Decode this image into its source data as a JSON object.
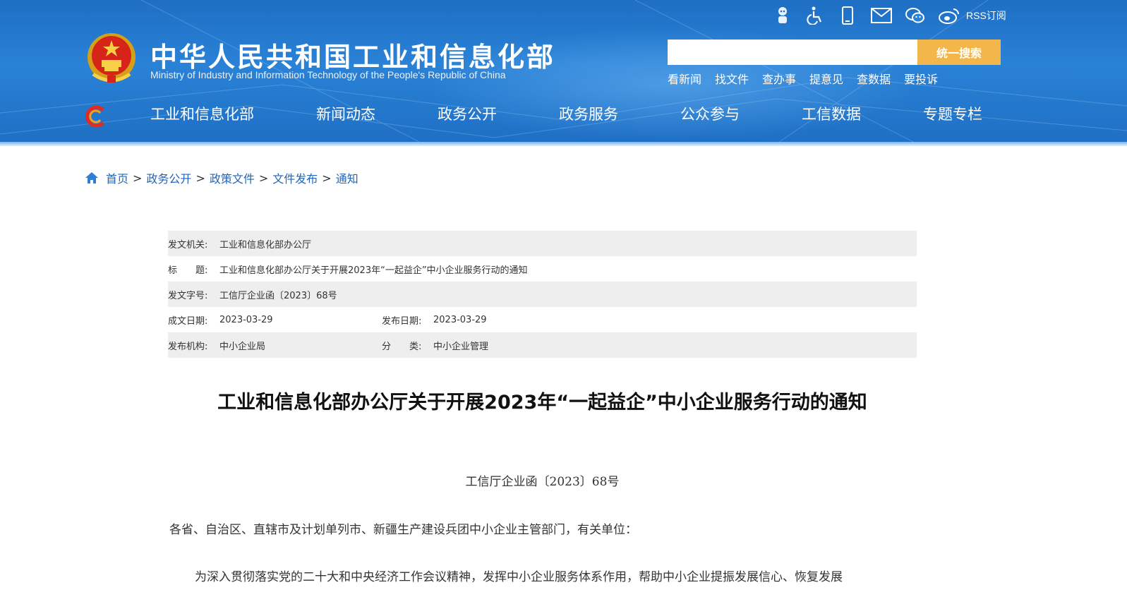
{
  "header": {
    "title_cn": "中华人民共和国工业和信息化部",
    "title_en": "Ministry of Industry and Information Technology of the People's Republic of China",
    "tools": [
      {
        "icon": "robot-icon"
      },
      {
        "icon": "accessibility-icon"
      },
      {
        "icon": "mobile-icon"
      },
      {
        "icon": "mail-icon"
      },
      {
        "icon": "wechat-icon"
      },
      {
        "icon": "weibo-icon"
      }
    ],
    "rss_label": "RSS订阅",
    "search": {
      "placeholder": "",
      "button_label": "统一搜索"
    },
    "quick_links": [
      "看新闻",
      "找文件",
      "查办事",
      "提意见",
      "查数据",
      "要投诉"
    ],
    "nav": [
      "工业和信息化部",
      "新闻动态",
      "政务公开",
      "政务服务",
      "公众参与",
      "工信数据",
      "专题专栏"
    ],
    "colors": {
      "header_blue": "#1e6fc4",
      "search_button": "#f2b64b",
      "link_blue": "#2266b8"
    }
  },
  "breadcrumb": {
    "items": [
      "首页",
      "政务公开",
      "政策文件",
      "文件发布",
      "通知"
    ],
    "separator": ">"
  },
  "meta": {
    "issuer_label": "发文机关:",
    "issuer": "工业和信息化部办公厅",
    "title_label": "标　　题:",
    "title": "工业和信息化部办公厅关于开展2023年“一起益企”中小企业服务行动的通知",
    "docno_label": "发文字号:",
    "docno": "工信厅企业函〔2023〕68号",
    "created_label": "成文日期:",
    "created": "2023-03-29",
    "published_label": "发布日期:",
    "published": "2023-03-29",
    "agency_label": "发布机构:",
    "agency": "中小企业局",
    "category_label": "分　　类:",
    "category": "中小企业管理"
  },
  "article": {
    "title": "工业和信息化部办公厅关于开展2023年“一起益企”中小企业服务行动的通知",
    "doc_number": "工信厅企业函〔2023〕68号",
    "salutation": "各省、自治区、直辖市及计划单列市、新疆生产建设兵团中小企业主管部门，有关单位：",
    "para1": "为深入贯彻落实党的二十大和中央经济工作会议精神，发挥中小企业服务体系作用，帮助中小企业提振发展信心、恢复发展"
  }
}
